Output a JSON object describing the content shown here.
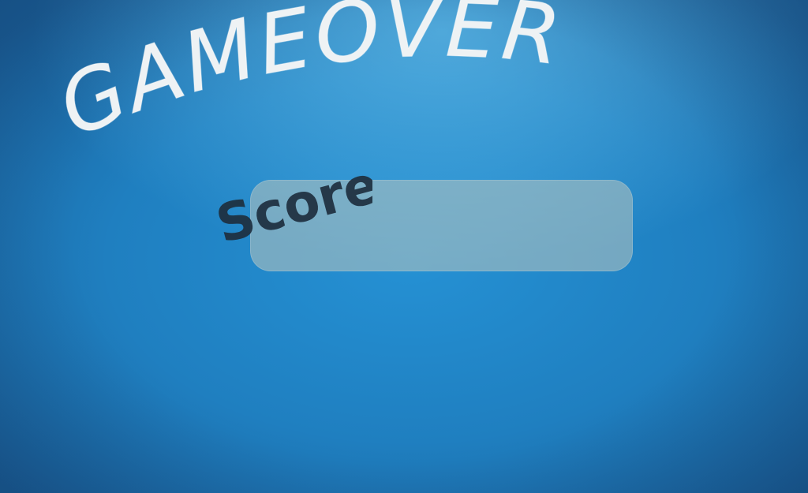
{
  "game": {
    "title": "GAMEOVER",
    "score_label": "Score",
    "score_value": ""
  },
  "colors": {
    "background_light": "#6fcaf2",
    "background_mid": "#2591d4",
    "background_dark": "#1b5f98",
    "title_text": "#eef2f4",
    "score_label_text": "#1e2f3f",
    "score_box": "#a6bcbc"
  }
}
